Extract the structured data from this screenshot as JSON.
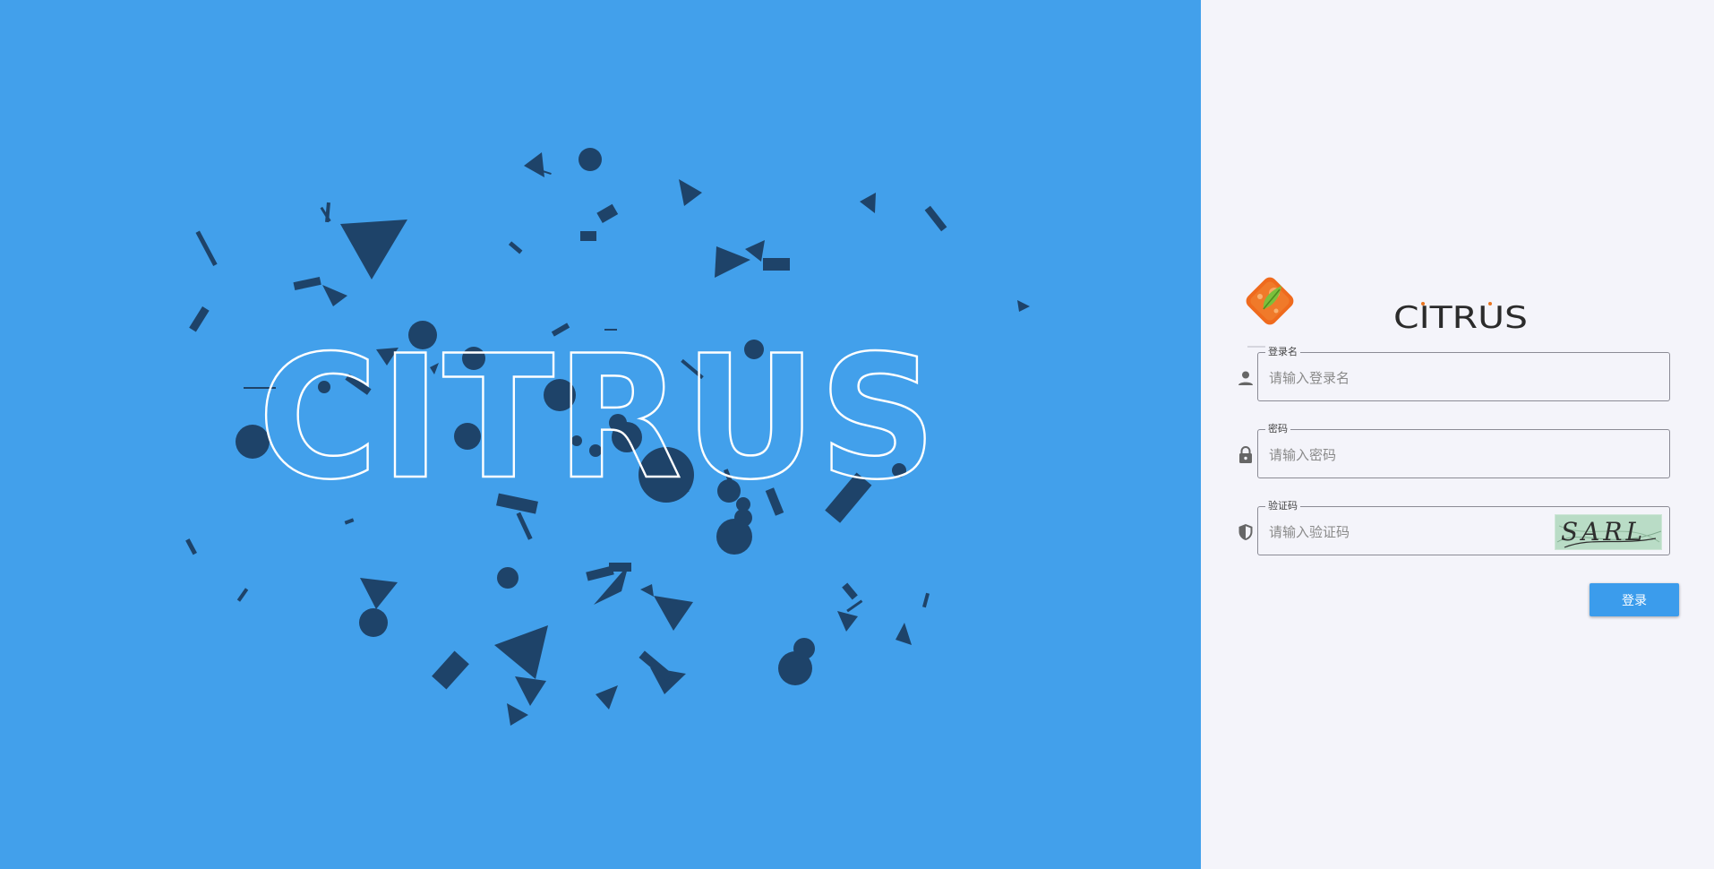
{
  "hero": {
    "brand_text": "CITRUS"
  },
  "brand": {
    "logo_icon": "citrus-leaf-logo-icon",
    "wordmark": "CITRUS"
  },
  "form": {
    "username": {
      "label": "登录名",
      "placeholder": "请输入登录名",
      "value": "",
      "icon": "person-icon"
    },
    "password": {
      "label": "密码",
      "placeholder": "请输入密码",
      "value": "",
      "icon": "lock-icon"
    },
    "captcha": {
      "label": "验证码",
      "placeholder": "请输入验证码",
      "value": "",
      "icon": "shield-icon",
      "image_text": "SARL"
    },
    "submit_label": "登录"
  },
  "colors": {
    "hero_bg": "#42a0eb",
    "panel_bg": "#f4f4fa",
    "button_bg": "#3b9cec",
    "shape_color": "#1d3f62"
  }
}
